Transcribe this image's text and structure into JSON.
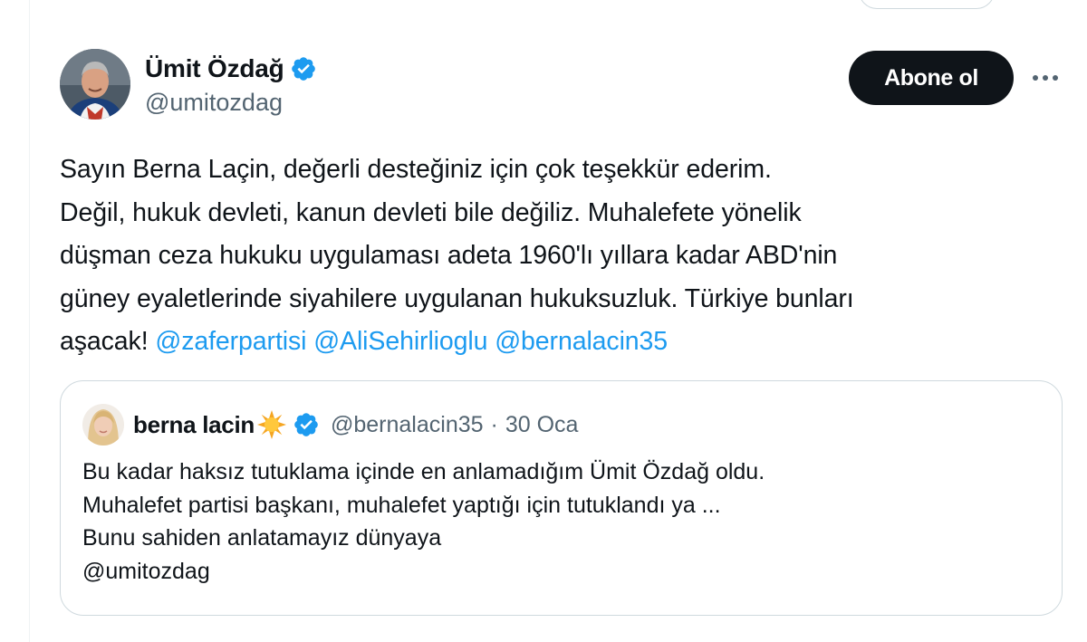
{
  "author": {
    "name": "Ümit Özdağ",
    "handle": "@umitozdag",
    "verified": true,
    "avatar_icon": "portrait-photo"
  },
  "actions": {
    "follow_label": "Abone ol",
    "more_icon": "more-horizontal-icon"
  },
  "tweet": {
    "lines": [
      "Sayın Berna Laçin, değerli desteğiniz için çok teşekkür ederim.",
      "Değil, hukuk devleti, kanun devleti bile değiliz. Muhalefete yönelik",
      "düşman ceza hukuku uygulaması adeta 1960'lı yıllara kadar ABD'nin",
      "güney eyaletlerinde siyahilere uygulanan hukuksuzluk. Türkiye bunları"
    ],
    "last_line_text": "aşacak!",
    "mentions": [
      "@zaferpartisi",
      "@AliSehirlioglu",
      "@bernalacin35"
    ]
  },
  "quoted_tweet": {
    "name": "berna lacin",
    "name_emoji": "sun-icon",
    "verified": true,
    "handle": "@bernalacin35",
    "separator": "·",
    "date": "30 Oca",
    "lines": [
      "Bu kadar haksız tutuklama içinde en anlamadığım Ümit Özdağ oldu.",
      "Muhalefet partisi başkanı, muhalefet yaptığı için tutuklandı ya ...",
      "Bunu sahiden anlatamayız dünyaya",
      "@umitozdag"
    ]
  },
  "colors": {
    "text": "#0f1419",
    "secondary": "#536471",
    "link": "#1d9bf0",
    "verified": "#1d9bf0",
    "border": "#cfd9de",
    "button_bg": "#0f1419"
  }
}
